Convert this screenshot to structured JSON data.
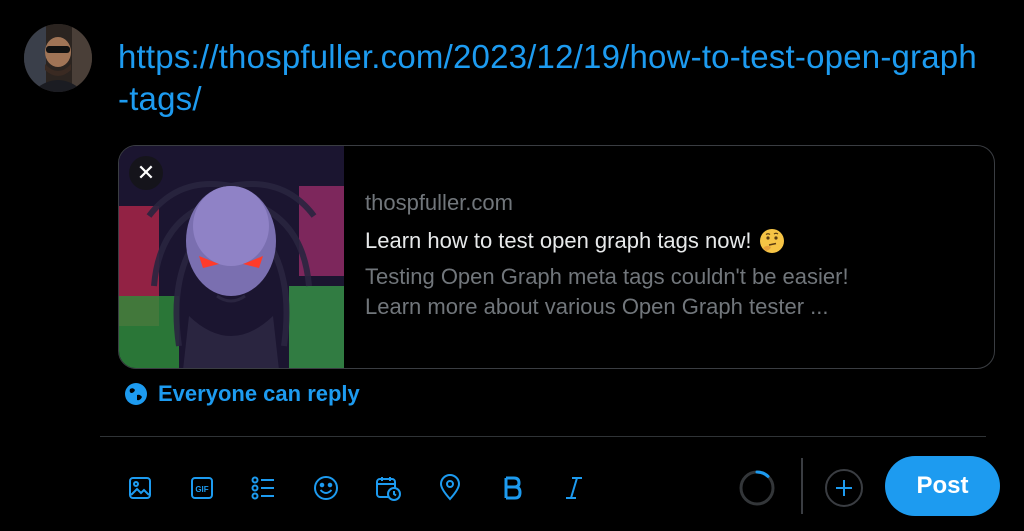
{
  "composer": {
    "text": "https://thospfuller.com/2023/12/19/how-to-test-open-graph-tags/"
  },
  "link_card": {
    "domain": "thospfuller.com",
    "title": "Learn how to test open graph tags now!",
    "title_emoji": "thinking-face",
    "description_line1": "Testing Open Graph meta tags couldn't be easier!",
    "description_line2": "Learn more about various Open Graph tester ..."
  },
  "reply_setting": {
    "label": "Everyone can reply"
  },
  "toolbar": {
    "icons": [
      "image-icon",
      "gif-icon",
      "poll-icon",
      "emoji-icon",
      "schedule-icon",
      "location-icon",
      "bold-icon",
      "italic-icon"
    ],
    "post_label": "Post",
    "char_progress": 0.12
  },
  "colors": {
    "accent": "#1d9bf0",
    "background": "#000000",
    "text": "#e7e9ea",
    "muted": "#71767b",
    "border": "#2f3336"
  }
}
